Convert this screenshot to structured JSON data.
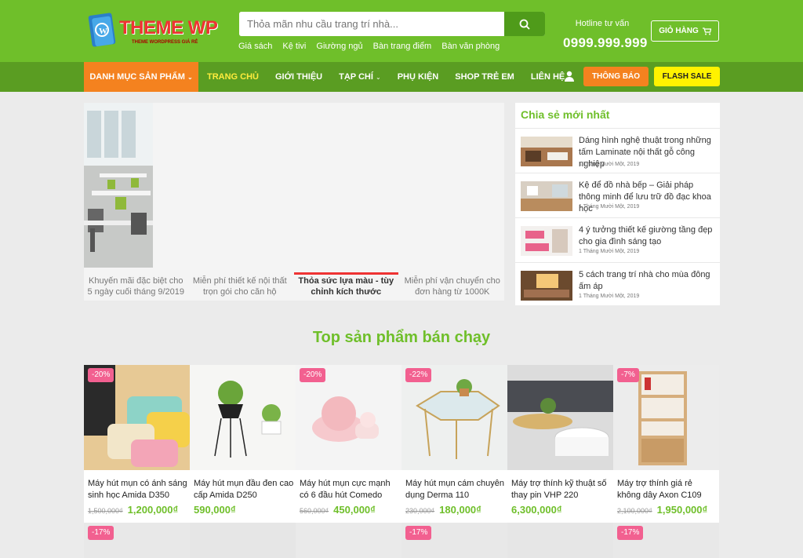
{
  "header": {
    "logo_text": "THEME WP",
    "logo_sub": "THEME WORDPRESS GIÁ RẺ",
    "search_placeholder": "Thỏa mãn nhu cầu trang trí nhà...",
    "quick_links": [
      "Giá sách",
      "Kệ tivi",
      "Giường ngủ",
      "Bàn trang điểm",
      "Bàn văn phòng"
    ],
    "hotline_label": "Hotline tư vấn",
    "hotline_number": "0999.999.999",
    "cart_label": "GIỎ HÀNG"
  },
  "nav": {
    "category_menu": "DANH MỤC SẢN PHẨM",
    "links": [
      "TRANG CHỦ",
      "GIỚI THIỆU",
      "TẠP CHÍ",
      "PHỤ KIỆN",
      "SHOP TRẺ EM",
      "LIÊN HỆ"
    ],
    "notify_label": "THÔNG BÁO",
    "flash_sale_label": "FLASH SALE"
  },
  "slider": {
    "tabs": [
      "Khuyến mãi đặc biệt cho 5 ngày cuối tháng 9/2019",
      "Miễn phí thiết kế nội thất trọn gói cho căn hộ",
      "Thỏa sức lựa màu - tùy chỉnh kích thước",
      "Miễn phí vận chuyển cho đơn hàng từ 1000K"
    ],
    "active_tab": 2
  },
  "news": {
    "title": "Chia sẻ mới nhất",
    "items": [
      {
        "title": "Dáng hình nghệ thuật trong những tấm Laminate nội thất gỗ công nghiệp",
        "date": "1 Tháng Mười Một, 2019"
      },
      {
        "title": "Kệ để đồ nhà bếp – Giải pháp thông minh để lưu trữ đồ đạc khoa học",
        "date": "1 Tháng Mười Một, 2019"
      },
      {
        "title": "4 ý tưởng thiết kế giường tầng đẹp cho gia đình sáng tạo",
        "date": "1 Tháng Mười Một, 2019"
      },
      {
        "title": "5 cách trang trí nhà cho mùa đông ấm áp",
        "date": "1 Tháng Mười Một, 2019"
      }
    ]
  },
  "products_section": {
    "title": "Top sản phẩm bán chạy",
    "items": [
      {
        "badge": "-20%",
        "name": "Máy hút mụn có ánh sáng sinh học Amida D350",
        "old_price": "1,500,000₫",
        "price": "1,200,000₫"
      },
      {
        "badge": "",
        "name": "Máy hút mụn đầu đen cao cấp Amida D250",
        "old_price": "",
        "price": "590,000₫"
      },
      {
        "badge": "-20%",
        "name": "Máy hút mụn cực mạnh có 6 đầu hút Comedo",
        "old_price": "560,000₫",
        "price": "450,000₫"
      },
      {
        "badge": "-22%",
        "name": "Máy hút mụn cám chuyên dụng Derma 110",
        "old_price": "230,000₫",
        "price": "180,000₫"
      },
      {
        "badge": "",
        "name": "Máy trợ thính kỹ thuật số thay pin VHP 220",
        "old_price": "",
        "price": "6,300,000₫"
      },
      {
        "badge": "-7%",
        "name": "Máy trợ thính giá rẻ không dây Axon C109",
        "old_price": "2,100,000₫",
        "price": "1,950,000₫"
      }
    ],
    "row2_badges": [
      "-17%",
      "",
      "",
      "-17%",
      "",
      "-17%"
    ]
  }
}
